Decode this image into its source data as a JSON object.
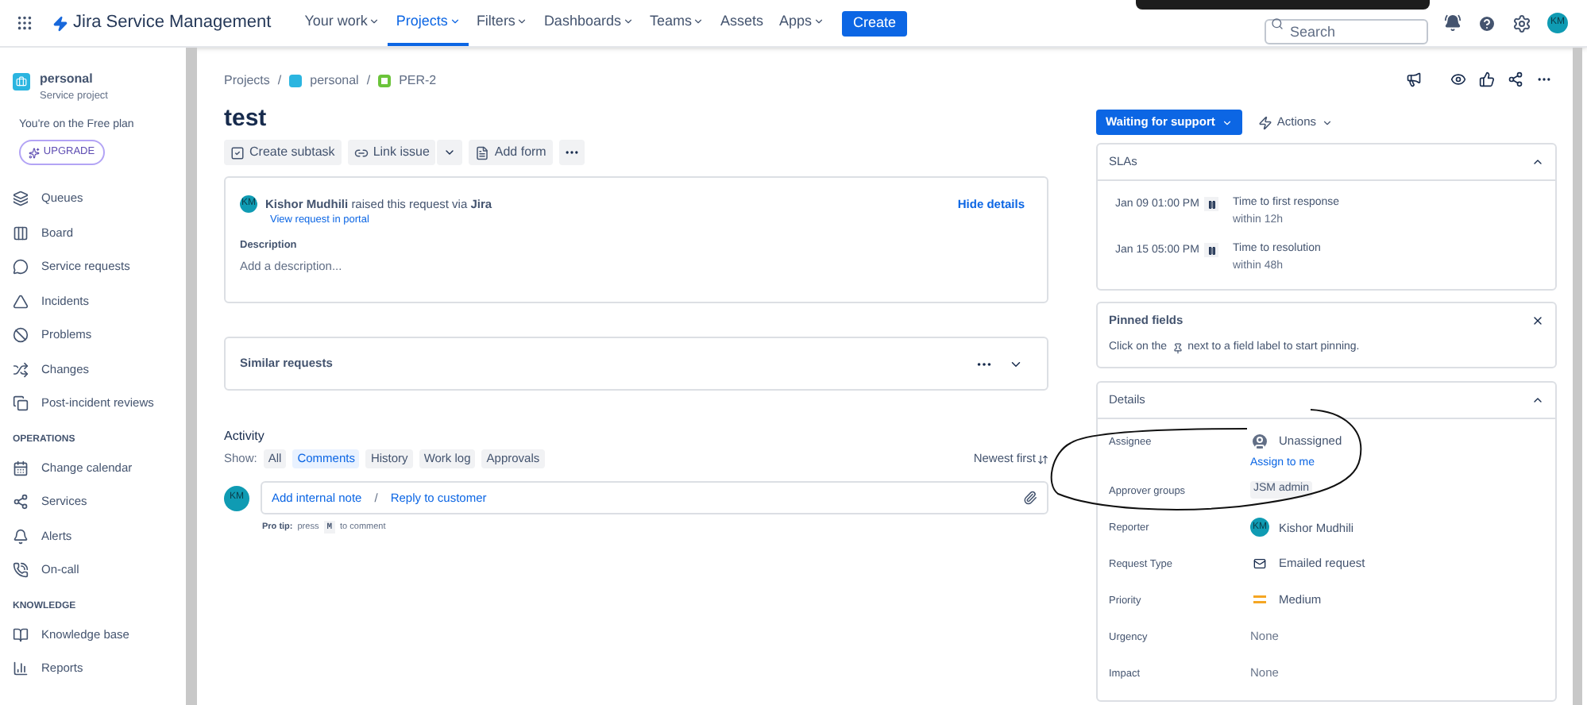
{
  "top_bar": {
    "product": "Jira Service Management",
    "menu": [
      {
        "label": "Your work",
        "dropdown": true,
        "selected": false
      },
      {
        "label": "Projects",
        "dropdown": true,
        "selected": true
      },
      {
        "label": "Filters",
        "dropdown": true,
        "selected": false
      },
      {
        "label": "Dashboards",
        "dropdown": true,
        "selected": false
      },
      {
        "label": "Teams",
        "dropdown": true,
        "selected": false
      },
      {
        "label": "Assets",
        "dropdown": false,
        "selected": false
      },
      {
        "label": "Apps",
        "dropdown": true,
        "selected": false
      }
    ],
    "create": "Create",
    "search": {
      "placeholder": "Search"
    },
    "avatar": "KM"
  },
  "sidebar": {
    "project": {
      "name": "personal",
      "type": "Service project"
    },
    "plan_note": "You're on the Free plan",
    "upgrade": "UPGRADE",
    "sections": [
      {
        "items": [
          {
            "label": "Queues"
          },
          {
            "label": "Board"
          },
          {
            "label": "Service requests"
          },
          {
            "label": "Incidents"
          },
          {
            "label": "Problems"
          },
          {
            "label": "Changes"
          },
          {
            "label": "Post-incident reviews"
          }
        ]
      },
      {
        "heading": "OPERATIONS",
        "items": [
          {
            "label": "Change calendar"
          },
          {
            "label": "Services"
          },
          {
            "label": "Alerts"
          },
          {
            "label": "On-call"
          }
        ]
      },
      {
        "heading": "KNOWLEDGE",
        "items": [
          {
            "label": "Knowledge base"
          },
          {
            "label": "Reports"
          }
        ]
      }
    ]
  },
  "breadcrumbs": [
    "Projects",
    "personal",
    "PER-2"
  ],
  "breadcrumb_separator": "/",
  "issue": {
    "title": "test",
    "toolbar": [
      "Create subtask",
      "Link issue",
      "Add form"
    ],
    "request": {
      "avatar": "KM",
      "reporter": "Kishor Mudhili",
      "raised_text": "raised this request via",
      "channel": "Jira",
      "hide_link": "Hide details",
      "portal_link": "View request in portal",
      "description_label": "Description",
      "description_placeholder": "Add a description..."
    },
    "similar": "Similar requests"
  },
  "activity": {
    "title": "Activity",
    "show_label": "Show:",
    "filters": [
      {
        "label": "All",
        "selected": false
      },
      {
        "label": "Comments",
        "selected": true
      },
      {
        "label": "History",
        "selected": false
      },
      {
        "label": "Work log",
        "selected": false
      },
      {
        "label": "Approvals",
        "selected": false
      }
    ],
    "sort": "Newest first",
    "avatar": "KM",
    "internal_note": "Add internal note",
    "separator": "/",
    "reply": "Reply to customer",
    "pro_tip": {
      "label": "Pro tip:",
      "before": "press",
      "key": "M",
      "after": "to comment"
    }
  },
  "status": {
    "label": "Waiting for support",
    "actions": "Actions"
  },
  "slas": {
    "title": "SLAs",
    "expanded": true,
    "items": [
      {
        "time": "Jan 09 01:00 PM",
        "goal": "Time to first response",
        "within": "within 12h"
      },
      {
        "time": "Jan 15 05:00 PM",
        "goal": "Time to resolution",
        "within": "within 48h"
      }
    ]
  },
  "pinned": {
    "title": "Pinned fields",
    "hint_before": "Click on the",
    "hint_after": "next to a field label to start pinning."
  },
  "details": {
    "title": "Details",
    "expanded": true,
    "fields": [
      {
        "label": "Assignee",
        "kind": "assignee",
        "value": "Unassigned",
        "action": "Assign to me"
      },
      {
        "label": "Approver groups",
        "kind": "tag",
        "value": "JSM admin"
      },
      {
        "label": "Reporter",
        "kind": "user",
        "avatar": "KM",
        "value": "Kishor Mudhili"
      },
      {
        "label": "Request Type",
        "kind": "request_type",
        "value": "Emailed request"
      },
      {
        "label": "Priority",
        "kind": "priority",
        "value": "Medium"
      },
      {
        "label": "Urgency",
        "kind": "empty",
        "value": "None"
      },
      {
        "label": "Impact",
        "kind": "empty",
        "value": "None"
      }
    ]
  }
}
